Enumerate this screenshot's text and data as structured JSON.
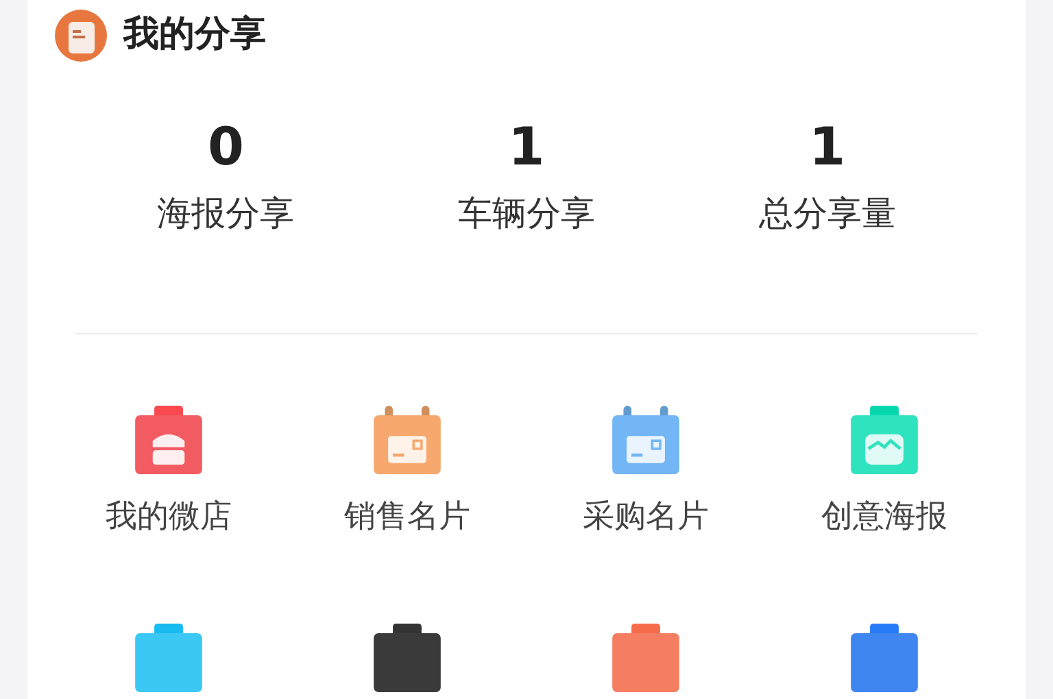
{
  "header": {
    "title": "我的分享"
  },
  "stats": [
    {
      "value": "0",
      "label": "海报分享"
    },
    {
      "value": "1",
      "label": "车辆分享"
    },
    {
      "value": "1",
      "label": "总分享量"
    }
  ],
  "apps": [
    {
      "label": "我的微店",
      "kind": "shop",
      "color": "#f25b61"
    },
    {
      "label": "销售名片",
      "kind": "card",
      "color": "#f7a86e"
    },
    {
      "label": "采购名片",
      "kind": "card",
      "color": "#72b6f5"
    },
    {
      "label": "创意海报",
      "kind": "poster",
      "color": "#2fe3be"
    }
  ],
  "more_apps": [
    {
      "color": "#3cc8f5"
    },
    {
      "color": "#3a3a3a"
    },
    {
      "color": "#f57e62"
    },
    {
      "color": "#3f86f0"
    }
  ]
}
